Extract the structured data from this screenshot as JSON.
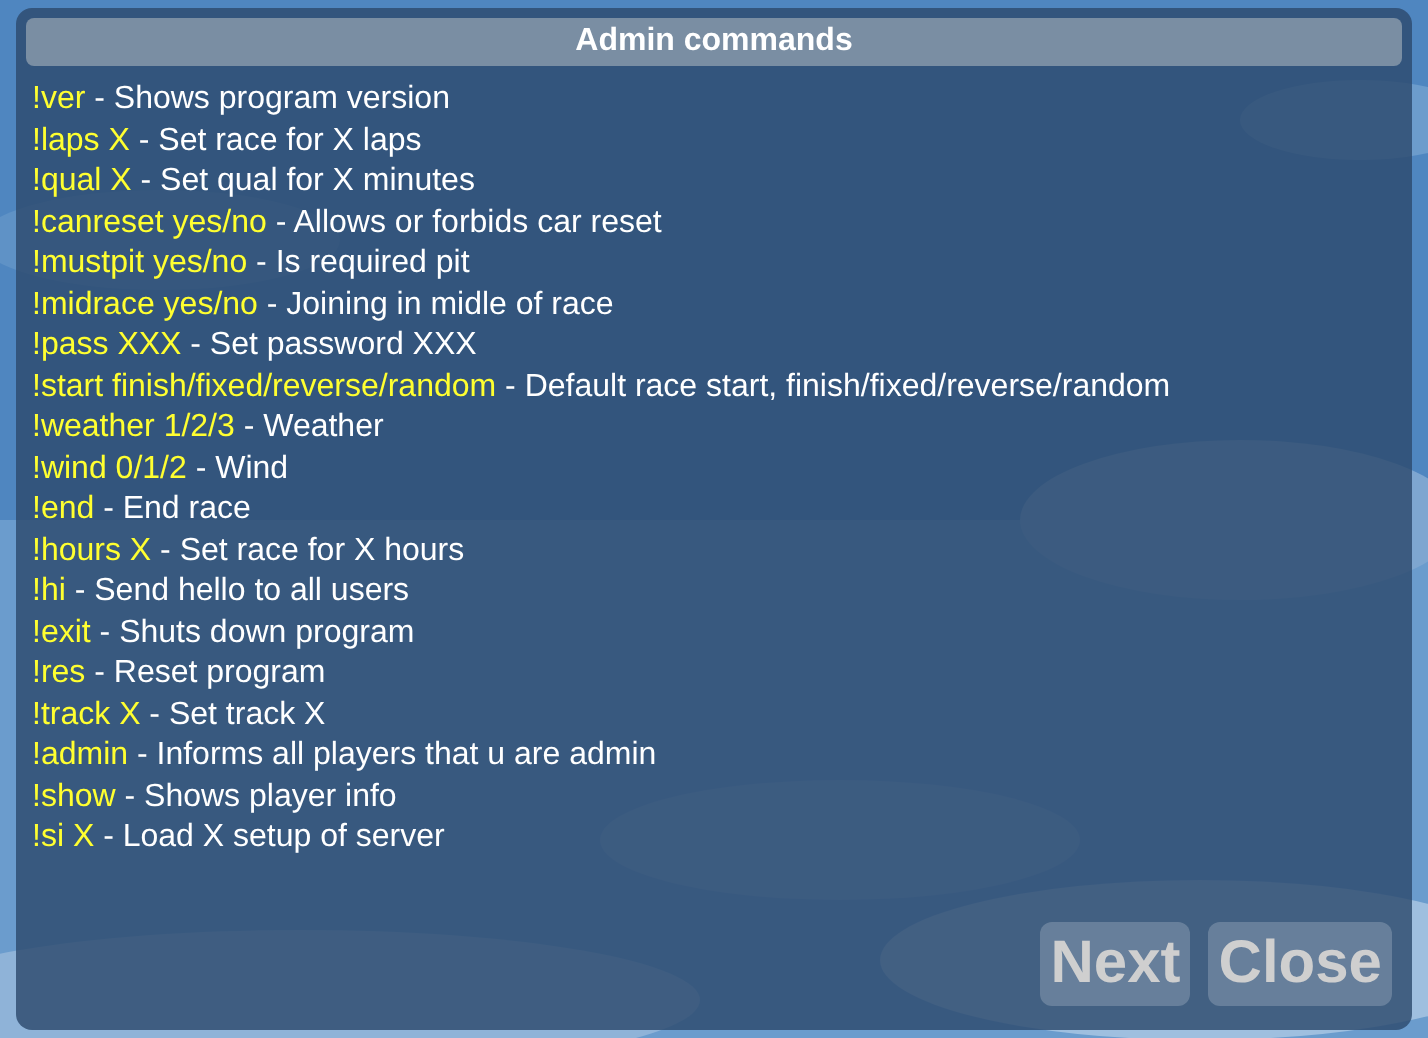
{
  "window": {
    "title": "Admin commands"
  },
  "commands": [
    {
      "command": "!ver",
      "description": "- Shows program version"
    },
    {
      "command": "!laps X",
      "description": "- Set race for X laps"
    },
    {
      "command": "!qual X",
      "description": "- Set qual for X minutes"
    },
    {
      "command": "!canreset yes/no",
      "description": "- Allows or forbids car reset"
    },
    {
      "command": "!mustpit yes/no",
      "description": "- Is required pit"
    },
    {
      "command": "!midrace yes/no",
      "description": "- Joining in midle of race"
    },
    {
      "command": "!pass XXX",
      "description": "- Set password XXX"
    },
    {
      "command": "!start finish/fixed/reverse/random",
      "description": "- Default race start, finish/fixed/reverse/random"
    },
    {
      "command": "!weather 1/2/3",
      "description": "- Weather"
    },
    {
      "command": "!wind 0/1/2",
      "description": "- Wind"
    },
    {
      "command": "!end",
      "description": "- End race"
    },
    {
      "command": "!hours X",
      "description": "- Set race for X hours"
    },
    {
      "command": "!hi",
      "description": "- Send hello to all users"
    },
    {
      "command": "!exit",
      "description": "- Shuts down program"
    },
    {
      "command": "!res",
      "description": "- Reset program"
    },
    {
      "command": "!track X",
      "description": "- Set track X"
    },
    {
      "command": "!admin",
      "description": "- Informs all players that u are admin"
    },
    {
      "command": "!show",
      "description": "- Shows player info"
    },
    {
      "command": "!si X",
      "description": "- Load X setup of server"
    }
  ],
  "buttons": [
    {
      "label": "Next",
      "disabled": true
    },
    {
      "label": "Close",
      "disabled": true
    }
  ]
}
